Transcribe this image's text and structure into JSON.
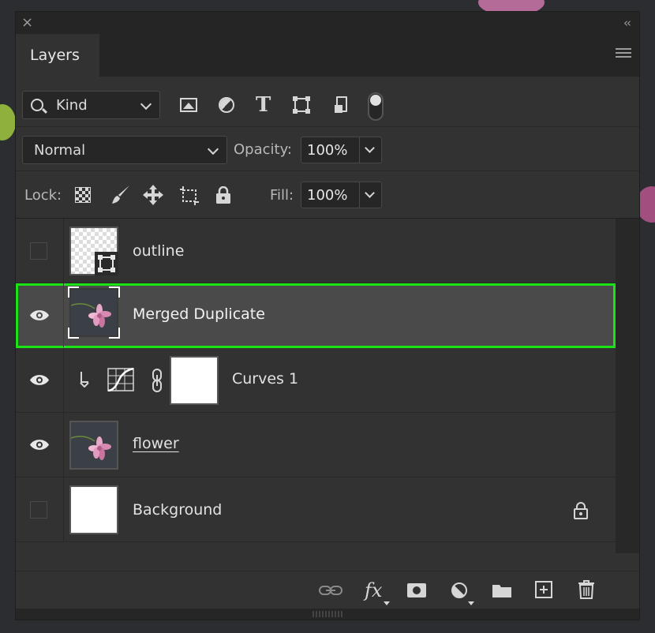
{
  "panel": {
    "close_glyph": "×",
    "collapse_glyph": "‹‹",
    "tab_label": "Layers"
  },
  "filter": {
    "kind_label": "Kind",
    "icons": [
      "image-filter-icon",
      "adjustment-filter-icon",
      "type-filter-icon",
      "shape-filter-icon",
      "smart-object-filter-icon"
    ]
  },
  "blend": {
    "mode": "Normal",
    "opacity_label": "Opacity:",
    "opacity_value": "100%"
  },
  "lock": {
    "label": "Lock:",
    "fill_label": "Fill:",
    "fill_value": "100%"
  },
  "layers": [
    {
      "name": "outline",
      "visible": false,
      "thumb": "transparent-with-shape-badge"
    },
    {
      "name": "Merged Duplicate",
      "visible": true,
      "selected": true,
      "thumb": "flower"
    },
    {
      "name": "Curves 1",
      "visible": true,
      "thumb": "curves-mask",
      "clipped": true
    },
    {
      "name": "flower",
      "visible": true,
      "thumb": "flower"
    },
    {
      "name": "Background",
      "visible": false,
      "thumb": "white",
      "locked": true
    }
  ],
  "bottom_bar": {
    "fx_label": "fx",
    "icons": [
      "link-layers-icon",
      "layer-style-icon",
      "add-mask-icon",
      "new-adjustment-icon",
      "new-group-icon",
      "new-layer-icon",
      "delete-layer-icon"
    ]
  },
  "colors": {
    "panel_bg": "#323232",
    "selection_outline": "#1ce315",
    "selected_row": "#4a4a4a"
  }
}
